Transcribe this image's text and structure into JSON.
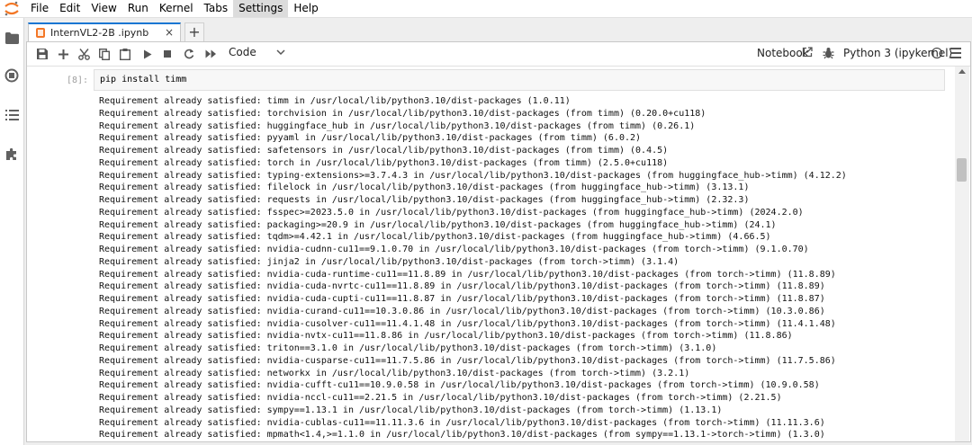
{
  "menu": [
    "File",
    "Edit",
    "View",
    "Run",
    "Kernel",
    "Tabs",
    "Settings",
    "Help"
  ],
  "tab": {
    "title": "InternVL2-2B .ipynb",
    "close": "×",
    "new": "+"
  },
  "toolbar": {
    "cell_type": "Code",
    "notebook_label": "Notebook",
    "kernel_name": "Python 3 (ipykernel)"
  },
  "cell": {
    "prompt": "[8]:",
    "input": "pip install timm",
    "output": [
      "Requirement already satisfied: timm in /usr/local/lib/python3.10/dist-packages (1.0.11)",
      "Requirement already satisfied: torchvision in /usr/local/lib/python3.10/dist-packages (from timm) (0.20.0+cu118)",
      "Requirement already satisfied: huggingface_hub in /usr/local/lib/python3.10/dist-packages (from timm) (0.26.1)",
      "Requirement already satisfied: pyyaml in /usr/local/lib/python3.10/dist-packages (from timm) (6.0.2)",
      "Requirement already satisfied: safetensors in /usr/local/lib/python3.10/dist-packages (from timm) (0.4.5)",
      "Requirement already satisfied: torch in /usr/local/lib/python3.10/dist-packages (from timm) (2.5.0+cu118)",
      "Requirement already satisfied: typing-extensions>=3.7.4.3 in /usr/local/lib/python3.10/dist-packages (from huggingface_hub->timm) (4.12.2)",
      "Requirement already satisfied: filelock in /usr/local/lib/python3.10/dist-packages (from huggingface_hub->timm) (3.13.1)",
      "Requirement already satisfied: requests in /usr/local/lib/python3.10/dist-packages (from huggingface_hub->timm) (2.32.3)",
      "Requirement already satisfied: fsspec>=2023.5.0 in /usr/local/lib/python3.10/dist-packages (from huggingface_hub->timm) (2024.2.0)",
      "Requirement already satisfied: packaging>=20.9 in /usr/local/lib/python3.10/dist-packages (from huggingface_hub->timm) (24.1)",
      "Requirement already satisfied: tqdm>=4.42.1 in /usr/local/lib/python3.10/dist-packages (from huggingface_hub->timm) (4.66.5)",
      "Requirement already satisfied: nvidia-cudnn-cu11==9.1.0.70 in /usr/local/lib/python3.10/dist-packages (from torch->timm) (9.1.0.70)",
      "Requirement already satisfied: jinja2 in /usr/local/lib/python3.10/dist-packages (from torch->timm) (3.1.4)",
      "Requirement already satisfied: nvidia-cuda-runtime-cu11==11.8.89 in /usr/local/lib/python3.10/dist-packages (from torch->timm) (11.8.89)",
      "Requirement already satisfied: nvidia-cuda-nvrtc-cu11==11.8.89 in /usr/local/lib/python3.10/dist-packages (from torch->timm) (11.8.89)",
      "Requirement already satisfied: nvidia-cuda-cupti-cu11==11.8.87 in /usr/local/lib/python3.10/dist-packages (from torch->timm) (11.8.87)",
      "Requirement already satisfied: nvidia-curand-cu11==10.3.0.86 in /usr/local/lib/python3.10/dist-packages (from torch->timm) (10.3.0.86)",
      "Requirement already satisfied: nvidia-cusolver-cu11==11.4.1.48 in /usr/local/lib/python3.10/dist-packages (from torch->timm) (11.4.1.48)",
      "Requirement already satisfied: nvidia-nvtx-cu11==11.8.86 in /usr/local/lib/python3.10/dist-packages (from torch->timm) (11.8.86)",
      "Requirement already satisfied: triton==3.1.0 in /usr/local/lib/python3.10/dist-packages (from torch->timm) (3.1.0)",
      "Requirement already satisfied: nvidia-cusparse-cu11==11.7.5.86 in /usr/local/lib/python3.10/dist-packages (from torch->timm) (11.7.5.86)",
      "Requirement already satisfied: networkx in /usr/local/lib/python3.10/dist-packages (from torch->timm) (3.2.1)",
      "Requirement already satisfied: nvidia-cufft-cu11==10.9.0.58 in /usr/local/lib/python3.10/dist-packages (from torch->timm) (10.9.0.58)",
      "Requirement already satisfied: nvidia-nccl-cu11==2.21.5 in /usr/local/lib/python3.10/dist-packages (from torch->timm) (2.21.5)",
      "Requirement already satisfied: sympy==1.13.1 in /usr/local/lib/python3.10/dist-packages (from torch->timm) (1.13.1)",
      "Requirement already satisfied: nvidia-cublas-cu11==11.11.3.6 in /usr/local/lib/python3.10/dist-packages (from torch->timm) (11.11.3.6)",
      "Requirement already satisfied: mpmath<1.4,>=1.1.0 in /usr/local/lib/python3.10/dist-packages (from sympy==1.13.1->torch->timm) (1.3.0)"
    ]
  },
  "icons": {
    "sidebar": [
      "folder-icon",
      "running-icon",
      "toc-icon",
      "extension-icon"
    ],
    "toolbar": [
      "save-icon",
      "add-cell-icon",
      "cut-icon",
      "copy-icon",
      "paste-icon",
      "run-icon",
      "stop-icon",
      "restart-icon",
      "run-all-icon"
    ]
  }
}
